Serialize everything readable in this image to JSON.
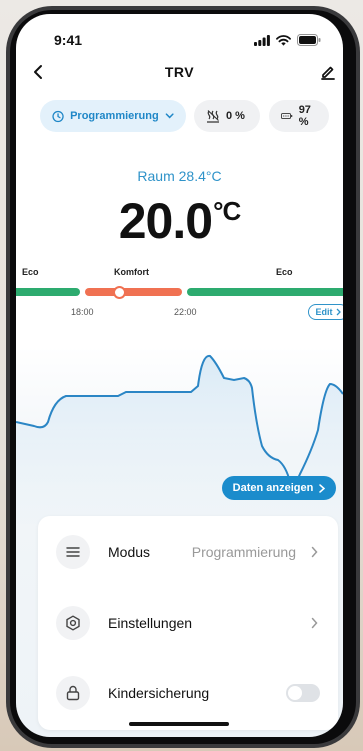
{
  "status_bar": {
    "time": "9:41"
  },
  "header": {
    "title": "TRV"
  },
  "chips": {
    "mode": "Programmierung",
    "humidity": "0 %",
    "battery": "97 %"
  },
  "room": {
    "label": "Raum 28.4°C"
  },
  "setpoint": {
    "value": "20.0",
    "unit": "°C"
  },
  "schedule": {
    "labels": {
      "eco_left": "Eco",
      "komfort": "Komfort",
      "eco_right": "Eco"
    },
    "times": {
      "start": "18:00",
      "end": "22:00"
    },
    "edit_label": "Edit",
    "colors": {
      "eco": "#2dab6f",
      "komfort": "#f07152"
    }
  },
  "chart": {
    "show_data_label": "Daten anzeigen",
    "line_color": "#2b86c5"
  },
  "settings": {
    "modus": {
      "label": "Modus",
      "value": "Programmierung"
    },
    "einstellungen": {
      "label": "Einstellungen"
    },
    "kindersicherung": {
      "label": "Kindersicherung",
      "enabled": false
    }
  }
}
